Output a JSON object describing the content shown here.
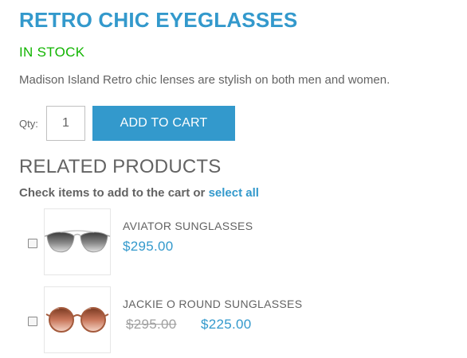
{
  "product": {
    "title": "RETRO CHIC EYEGLASSES",
    "stock_status": "IN STOCK",
    "description": "Madison Island Retro chic lenses are stylish on both men and women."
  },
  "cart": {
    "qty_label": "Qty:",
    "qty_value": "1",
    "add_button": "ADD TO CART"
  },
  "related": {
    "heading": "RELATED PRODUCTS",
    "hint_prefix": "Check items to add to the cart or",
    "select_all": "select all",
    "items": [
      {
        "name": "AVIATOR SUNGLASSES",
        "price": "$295.00",
        "image_icon": "aviator-sunglasses-image"
      },
      {
        "name": "JACKIE O ROUND SUNGLASSES",
        "old_price": "$295.00",
        "price": "$225.00",
        "image_icon": "round-sunglasses-image"
      }
    ]
  },
  "colors": {
    "accent": "#3399cc",
    "in_stock": "#11b400",
    "text": "#636363",
    "muted": "#a0a0a0"
  }
}
